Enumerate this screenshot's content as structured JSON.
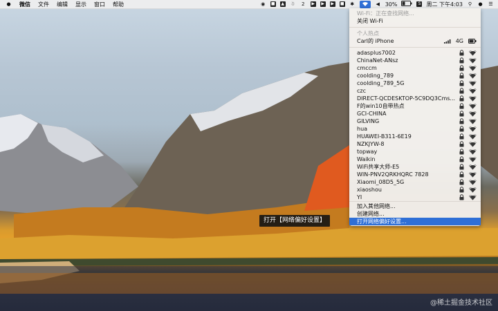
{
  "menubar": {
    "apple_icon": "apple-icon",
    "app_name": "微信",
    "menus": [
      "文件",
      "编辑",
      "显示",
      "窗口",
      "帮助"
    ],
    "status": {
      "notification_count": "2",
      "battery_percent": "30%",
      "datetime": "周二 下午4:03"
    }
  },
  "wifi_menu": {
    "status": "Wi-Fi：正在查找网络...",
    "toggle": "关闭 Wi-Fi",
    "hotspot_header": "个人热点",
    "hotspot": {
      "name": "Carl的 iPhone",
      "network": "4G"
    },
    "networks": [
      "adasplus7002",
      "ChinaNet-ANsz",
      "cmccm",
      "coolding_789",
      "coolding_789_5G",
      "czc",
      "DIRECT-QCDESKTOP-5C9DQ3Cms...",
      "F的win10自带热点",
      "GCI-CHINA",
      "GILVING",
      "hua",
      "HUAWEI-B311-6E19",
      "NZKJYW-8",
      "topway",
      "Waikin",
      "WiFi共享大师-E5",
      "WIN-PNV2QRKHQRC 7828",
      "Xiaomi_08D5_5G",
      "xiaoshou",
      "YI"
    ],
    "join_other": "加入其他网络...",
    "create_network": "创建网络...",
    "open_prefs": "打开网络偏好设置..."
  },
  "tooltip": "打开【网络偏好设置】",
  "watermark": "@稀土掘金技术社区"
}
